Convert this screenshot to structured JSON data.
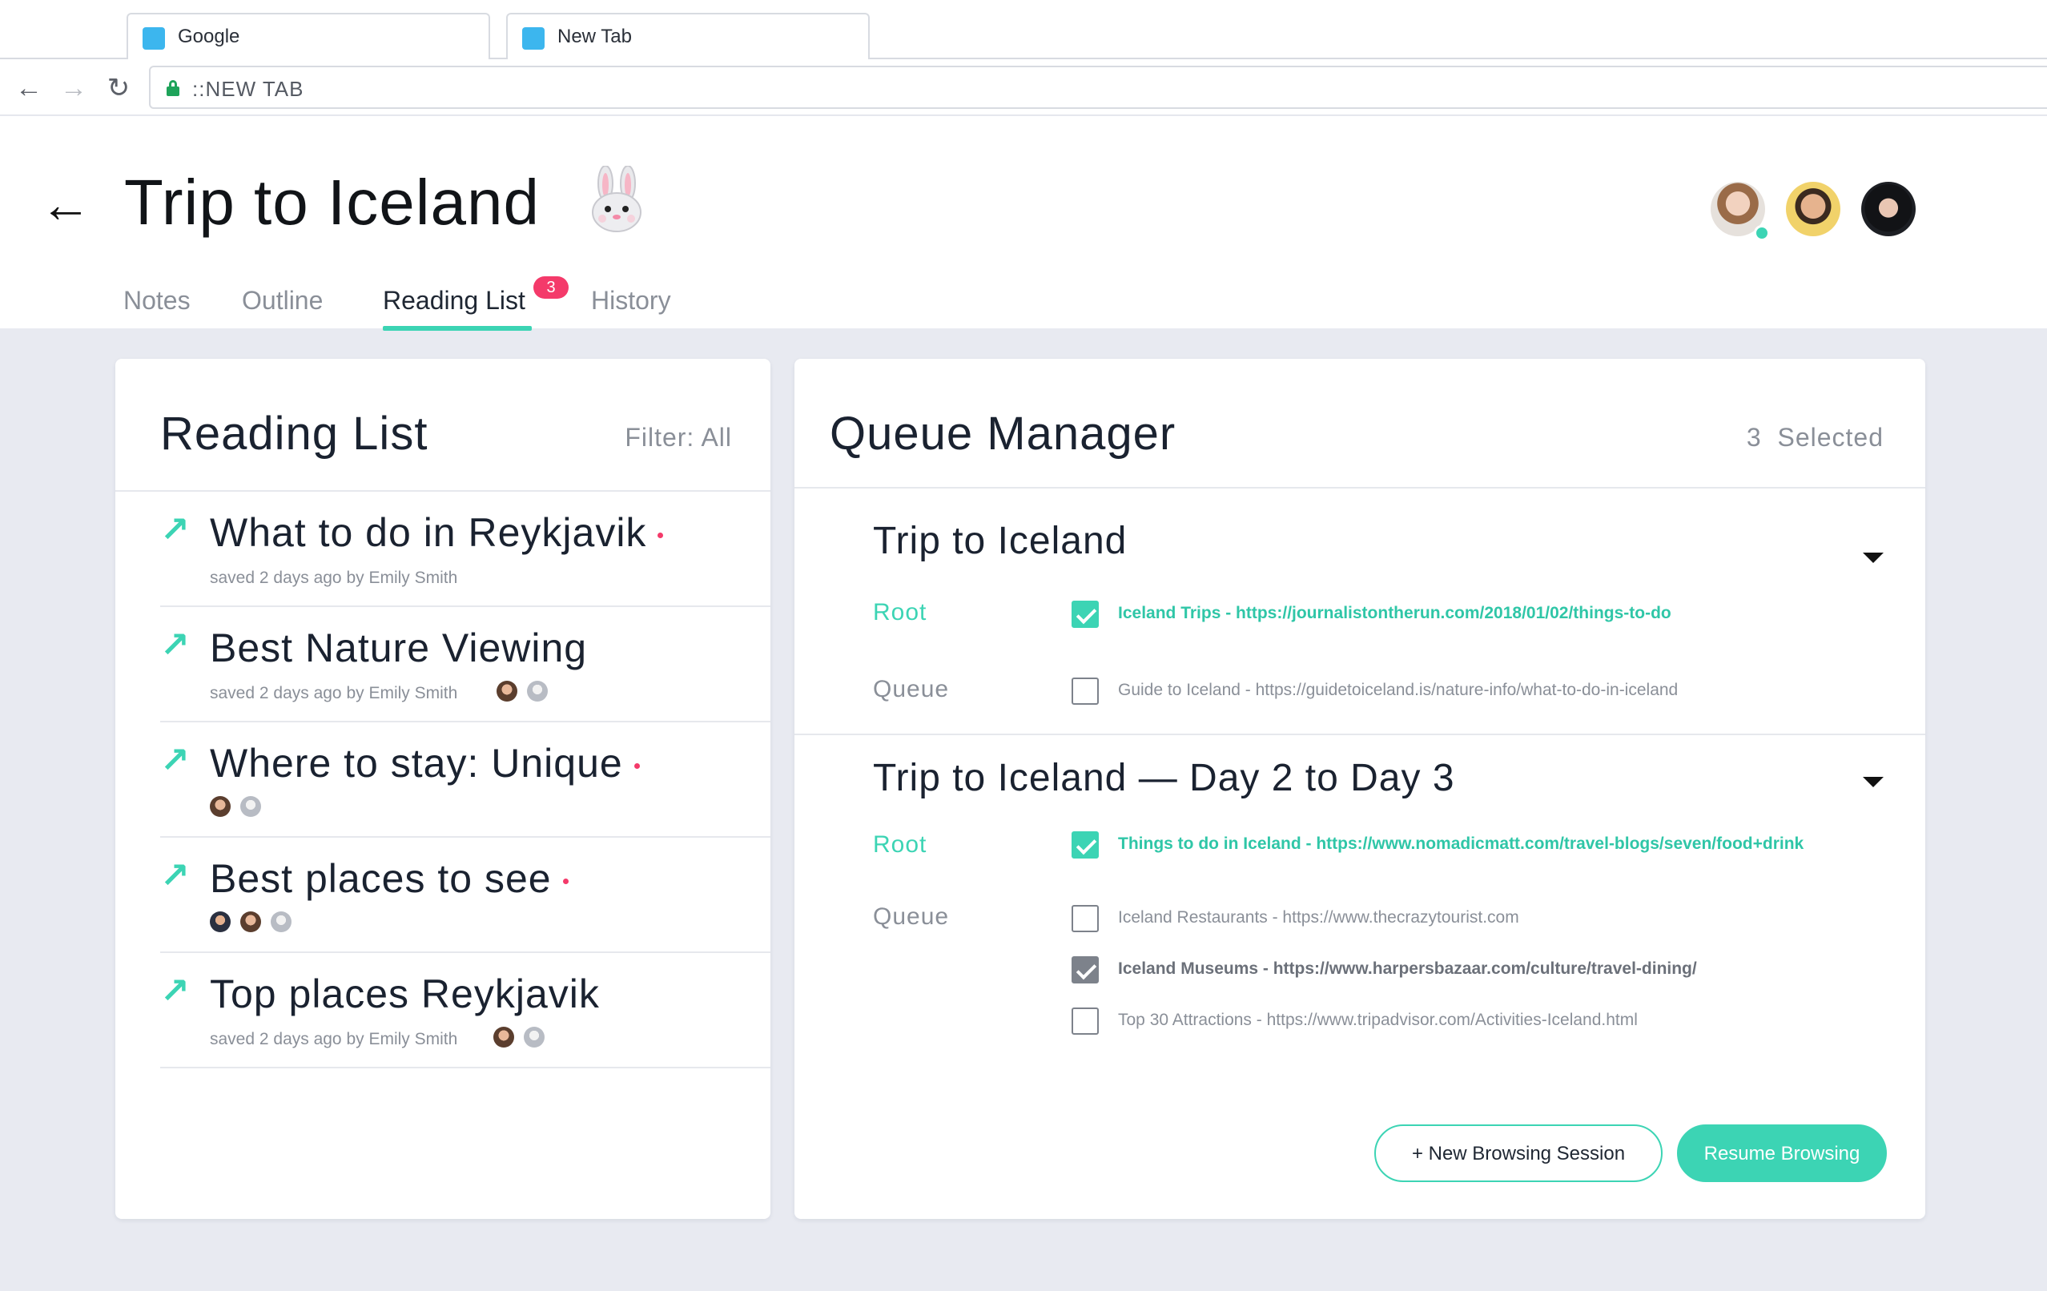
{
  "browser": {
    "tabs": [
      {
        "title": "Google"
      },
      {
        "title": "New Tab"
      }
    ],
    "url": "::NEW TAB"
  },
  "header": {
    "title": "Trip to Iceland",
    "emoji": "rabbit",
    "tabs": [
      {
        "label": "Notes"
      },
      {
        "label": "Outline"
      },
      {
        "label": "Reading List",
        "badge": "3",
        "active": true
      },
      {
        "label": "History"
      }
    ]
  },
  "reading_list": {
    "title": "Reading List",
    "filter": "Filter: All",
    "items": [
      {
        "title": "What to do in Reykjavik",
        "meta": "saved 2 days ago by Emily Smith",
        "unread": true
      },
      {
        "title": "Best Nature Viewing",
        "meta": "saved 2 days ago by Emily Smith",
        "unread": false
      },
      {
        "title": "Where to stay: Unique",
        "meta": "",
        "unread": true
      },
      {
        "title": "Best places to see",
        "meta": "",
        "unread": true
      },
      {
        "title": "Top places Reykjavik",
        "meta": "saved 2 days ago by Emily Smith",
        "unread": false
      }
    ]
  },
  "queue": {
    "title": "Queue Manager",
    "selected_count": "3",
    "selected_label": "Selected",
    "root_label": "Root",
    "queue_label": "Queue",
    "groups": [
      {
        "title": "Trip to Iceland",
        "root": {
          "text": "Iceland Trips - https://journalistontherun.com/2018/01/02/things-to-do",
          "checked": true
        },
        "queue": [
          {
            "text": "Guide to Iceland - https://guidetoiceland.is/nature-info/what-to-do-in-iceland",
            "checked": false
          }
        ]
      },
      {
        "title": "Trip to Iceland — Day 2 to Day 3",
        "root": {
          "text": "Things to do in Iceland - https://www.nomadicmatt.com/travel-blogs/seven/food+drink",
          "checked": true
        },
        "queue": [
          {
            "text": "Iceland Restaurants - https://www.thecrazytourist.com",
            "checked": false
          },
          {
            "text": "Iceland Museums - https://www.harpersbazaar.com/culture/travel-dining/",
            "checked": true
          },
          {
            "text": "Top 30 Attractions - https://www.tripadvisor.com/Activities-Iceland.html",
            "checked": false
          }
        ]
      }
    ],
    "buttons": {
      "new_session": "+ New Browsing Session",
      "resume": "Resume Browsing"
    }
  },
  "colors": {
    "accent": "#3cd4b4",
    "badge": "#f43a6a",
    "background": "#e8eaf1"
  }
}
